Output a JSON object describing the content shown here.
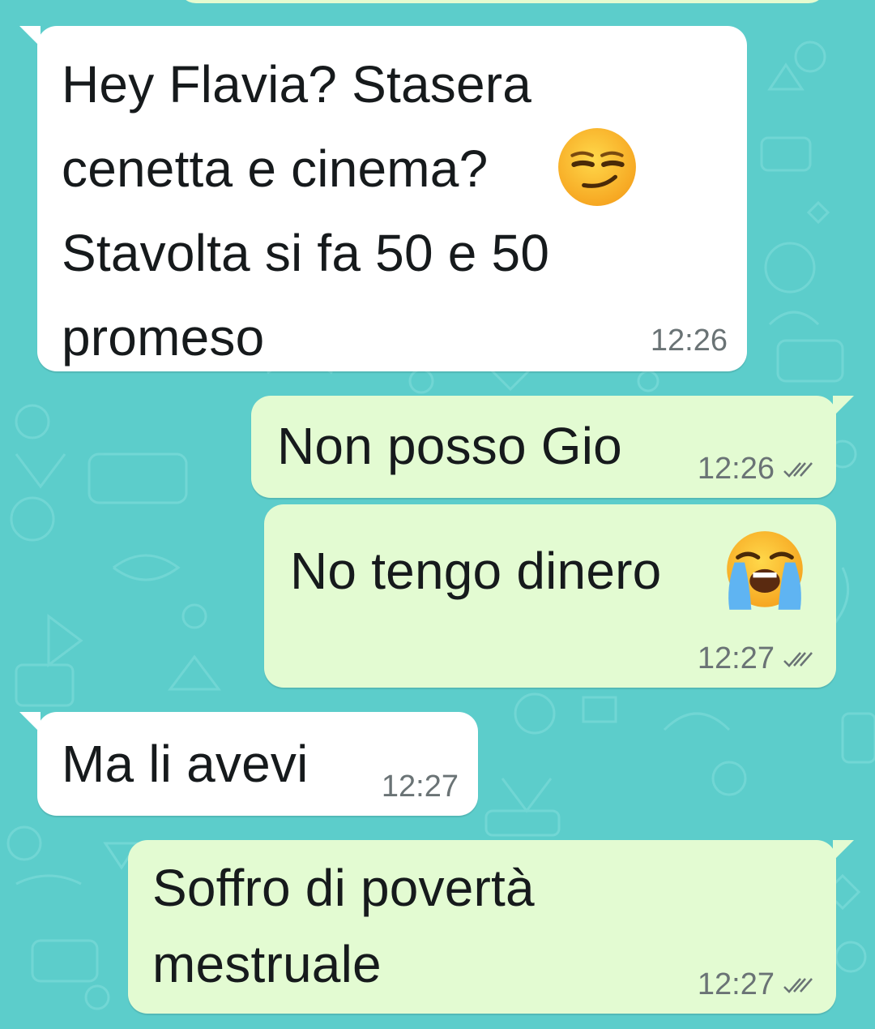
{
  "conversation": {
    "messages": [
      {
        "direction": "incoming",
        "text": "Hey Flavia? Stasera\ncenetta e cinema?\nStavolta si fa 50 e 50\npromeso",
        "time": "12:26"
      },
      {
        "direction": "outgoing",
        "text": "Non posso Gio",
        "time": "12:26",
        "status": "read"
      },
      {
        "direction": "outgoing",
        "text": "No tengo dinero",
        "time": "12:27",
        "status": "read"
      },
      {
        "direction": "incoming",
        "text": "Ma li avevi",
        "time": "12:27"
      },
      {
        "direction": "outgoing",
        "text": "Soffro di povertà\nmestruale",
        "time": "12:27",
        "status": "read"
      }
    ],
    "emoji": {
      "message_0": "smirking-face",
      "message_2": "loudly-crying-face"
    }
  },
  "colors": {
    "wallpaper": "#5ccdcb",
    "incoming_bubble": "#ffffff",
    "outgoing_bubble": "#e3fbd2",
    "timestamp": "#6a7375",
    "read_ticks": "#6a7375"
  }
}
